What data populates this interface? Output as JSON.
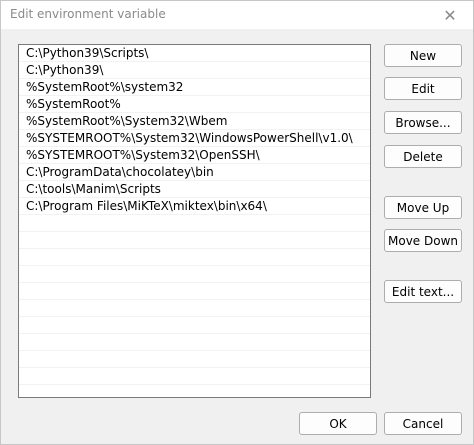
{
  "window": {
    "title": "Edit environment variable",
    "close_icon": "close-icon"
  },
  "list": {
    "items": [
      "C:\\Python39\\Scripts\\",
      "C:\\Python39\\",
      "%SystemRoot%\\system32",
      "%SystemRoot%",
      "%SystemRoot%\\System32\\Wbem",
      "%SYSTEMROOT%\\System32\\WindowsPowerShell\\v1.0\\",
      "%SYSTEMROOT%\\System32\\OpenSSH\\",
      "C:\\ProgramData\\chocolatey\\bin",
      "C:\\tools\\Manim\\Scripts",
      "C:\\Program Files\\MiKTeX\\miktex\\bin\\x64\\"
    ]
  },
  "buttons": {
    "new": "New",
    "edit": "Edit",
    "browse": "Browse...",
    "delete": "Delete",
    "move_up": "Move Up",
    "move_down": "Move Down",
    "edit_text": "Edit text...",
    "ok": "OK",
    "cancel": "Cancel"
  }
}
